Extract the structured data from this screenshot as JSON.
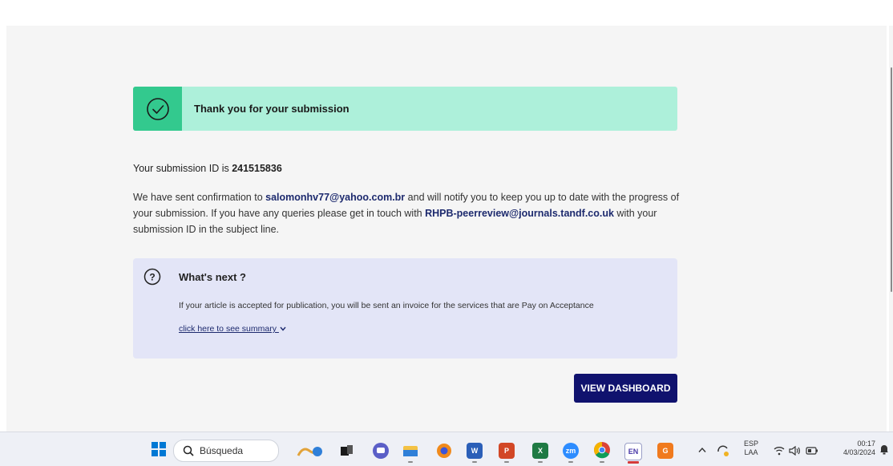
{
  "banner": {
    "message": "Thank you for your submission",
    "icon": "check-circle-icon"
  },
  "submission": {
    "id_prefix": "Your submission ID is ",
    "id": "241515836"
  },
  "confirmation": {
    "part1": "We have sent confirmation to ",
    "email": "salomonhv77@yahoo.com.br",
    "part2": " and will notify you to keep you up to date with the progress of your submission. If you have any queries please get in touch with ",
    "contact": "RHPB-peerreview@journals.tandf.co.uk",
    "part3": " with your submission ID in the subject line."
  },
  "next": {
    "icon": "question-circle-icon",
    "title": "What's next ?",
    "body": "If your article is accepted for publication, you will be sent an invoice for the services that are Pay on Acceptance",
    "summary_link": "click here to see summary "
  },
  "actions": {
    "view_dashboard": "VIEW DASHBOARD"
  },
  "taskbar": {
    "search_label": "Búsqueda",
    "apps": [
      {
        "name": "widgets-icon"
      },
      {
        "name": "task-view-icon"
      },
      {
        "name": "teams-chat-icon"
      },
      {
        "name": "file-explorer-icon"
      },
      {
        "name": "browser-icon"
      },
      {
        "name": "word-icon",
        "letter": "W"
      },
      {
        "name": "powerpoint-icon",
        "letter": "P"
      },
      {
        "name": "excel-icon",
        "letter": "X"
      },
      {
        "name": "zoom-icon",
        "letter": "zm"
      },
      {
        "name": "chrome-icon"
      },
      {
        "name": "endnote-icon",
        "letter": "EN"
      },
      {
        "name": "orange-app-icon",
        "letter": "G"
      }
    ],
    "tray": {
      "language": "ESP",
      "layout": "LAA",
      "time": "00:17",
      "date": "4/03/2024"
    }
  },
  "colors": {
    "banner_bg": "#adf0da",
    "banner_icon_bg": "#33c98e",
    "next_box_bg": "#e3e5f7",
    "primary_button": "#10126e",
    "link": "#1d2a6e"
  }
}
